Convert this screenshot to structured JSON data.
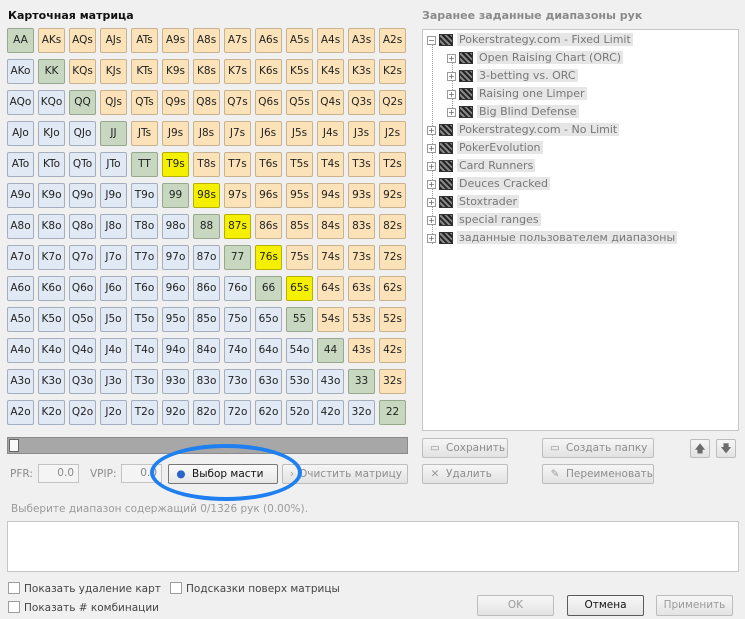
{
  "left_title": "Карточная матрица",
  "right_title": "Заранее заданные диапазоны рук",
  "matrix": [
    [
      "AA",
      "AKs",
      "AQs",
      "AJs",
      "ATs",
      "A9s",
      "A8s",
      "A7s",
      "A6s",
      "A5s",
      "A4s",
      "A3s",
      "A2s"
    ],
    [
      "AKo",
      "KK",
      "KQs",
      "KJs",
      "KTs",
      "K9s",
      "K8s",
      "K7s",
      "K6s",
      "K5s",
      "K4s",
      "K3s",
      "K2s"
    ],
    [
      "AQo",
      "KQo",
      "QQ",
      "QJs",
      "QTs",
      "Q9s",
      "Q8s",
      "Q7s",
      "Q6s",
      "Q5s",
      "Q4s",
      "Q3s",
      "Q2s"
    ],
    [
      "AJo",
      "KJo",
      "QJo",
      "JJ",
      "JTs",
      "J9s",
      "J8s",
      "J7s",
      "J6s",
      "J5s",
      "J4s",
      "J3s",
      "J2s"
    ],
    [
      "ATo",
      "KTo",
      "QTo",
      "JTo",
      "TT",
      "T9s",
      "T8s",
      "T7s",
      "T6s",
      "T5s",
      "T4s",
      "T3s",
      "T2s"
    ],
    [
      "A9o",
      "K9o",
      "Q9o",
      "J9o",
      "T9o",
      "99",
      "98s",
      "97s",
      "96s",
      "95s",
      "94s",
      "93s",
      "92s"
    ],
    [
      "A8o",
      "K8o",
      "Q8o",
      "J8o",
      "T8o",
      "98o",
      "88",
      "87s",
      "86s",
      "85s",
      "84s",
      "83s",
      "82s"
    ],
    [
      "A7o",
      "K7o",
      "Q7o",
      "J7o",
      "T7o",
      "97o",
      "87o",
      "77",
      "76s",
      "75s",
      "74s",
      "73s",
      "72s"
    ],
    [
      "A6o",
      "K6o",
      "Q6o",
      "J6o",
      "T6o",
      "96o",
      "86o",
      "76o",
      "66",
      "65s",
      "64s",
      "63s",
      "62s"
    ],
    [
      "A5o",
      "K5o",
      "Q5o",
      "J5o",
      "T5o",
      "95o",
      "85o",
      "75o",
      "65o",
      "55",
      "54s",
      "53s",
      "52s"
    ],
    [
      "A4o",
      "K4o",
      "Q4o",
      "J4o",
      "T4o",
      "94o",
      "84o",
      "74o",
      "64o",
      "54o",
      "44",
      "43s",
      "42s"
    ],
    [
      "A3o",
      "K3o",
      "Q3o",
      "J3o",
      "T3o",
      "93o",
      "83o",
      "73o",
      "63o",
      "53o",
      "43o",
      "33",
      "32s"
    ],
    [
      "A2o",
      "K2o",
      "Q2o",
      "J2o",
      "T2o",
      "92o",
      "82o",
      "72o",
      "62o",
      "52o",
      "42o",
      "32o",
      "22"
    ]
  ],
  "selected_hands": [
    "T9s",
    "98s",
    "87s",
    "76s",
    "65s"
  ],
  "colors": {
    "suited": "#fbe2b8",
    "offsuit": "#e1e9f4",
    "pair": "#c8d8c0",
    "selected": "#f4f000",
    "highlight_ring": "#1e7ff0"
  },
  "pfr_label": "PFR:",
  "pfr_value": "0.0",
  "vpip_label": "VPIP:",
  "vpip_value": "0.0",
  "suit_button": "Выбор масти",
  "clear_button": "Очистить матрицу",
  "status": "Выберите диапазон содержащий 0/1326 рук (0.00%).",
  "tree": [
    {
      "label": "Pokerstrategy.com - Fixed Limit",
      "expanded": true,
      "children": [
        "Open Raising Chart (ORC)",
        "3-betting vs. ORC",
        "Raising one Limper",
        "Big Blind Defense"
      ]
    },
    {
      "label": "Pokerstrategy.com - No Limit"
    },
    {
      "label": "PokerEvolution"
    },
    {
      "label": "Card Runners"
    },
    {
      "label": "Deuces Cracked"
    },
    {
      "label": "Stoxtrader"
    },
    {
      "label": "special ranges"
    },
    {
      "label": "заданные пользователем диапазоны"
    }
  ],
  "tree_buttons": {
    "save": "Сохранить",
    "create_folder": "Создать папку",
    "delete": "Удалить",
    "rename": "Переименовать"
  },
  "checkboxes": {
    "show_removal": "Показать удаление карт",
    "hints_over_matrix": "Подсказки поверх матрицы",
    "show_combos": "Показать # комбинации"
  },
  "dialog_buttons": {
    "ok": "OK",
    "cancel": "Отмена",
    "apply": "Применить"
  }
}
